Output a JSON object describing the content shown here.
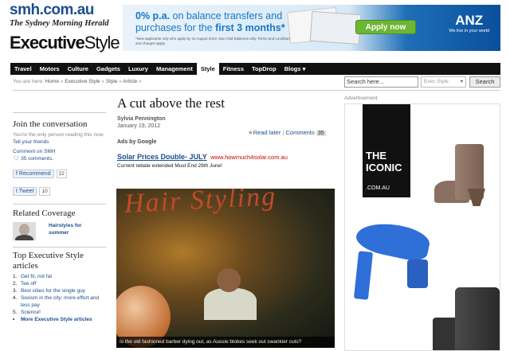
{
  "masthead": {
    "site": "smh.com.au",
    "paper": "The Sydney Morning Herald",
    "section_a": "Executive",
    "section_b": "Style"
  },
  "banner": {
    "headline_a": "0% p.a.",
    "headline_b": " on balance transfers and",
    "headline_c": "purchases for the ",
    "headline_d": "first 3 months*",
    "small_print": "*New applicants only who apply by 31 August 2012. Non ANZ balances only. Terms and conditions, fees and charges apply.",
    "apply_label": "Apply now",
    "brand": "ANZ",
    "brand_tagline": "We live in your world"
  },
  "nav": {
    "items": [
      "Travel",
      "Motors",
      "Culture",
      "Gadgets",
      "Luxury",
      "Management",
      "Style",
      "Fitness",
      "TopDrop",
      "Blogs ▾"
    ],
    "active_index": 6
  },
  "breadcrumb": {
    "prefix": "You are here:",
    "items": [
      "Home",
      "Executive Style",
      "Style",
      "Article"
    ]
  },
  "search": {
    "placeholder": "Search here...",
    "scope": "Exec Style",
    "button": "Search"
  },
  "left": {
    "join_title": "Join the conversation",
    "join_text": "You're the only person reading this now.",
    "join_link": "Tell your friends",
    "comment_on": "Comment on SMH",
    "comments_count": "35 comments.",
    "recommend_label": "Recommend",
    "recommend_count": "22",
    "tweet_label": "Tweet",
    "tweet_count": "10",
    "related_title": "Related Coverage",
    "related_item": "Hairstyles for summer",
    "top_title": "Top Executive Style articles",
    "top_items": [
      "Get fit, not fat",
      "Tee off",
      "Best cities for the single guy",
      "Sexism in the city: more effort and less pay",
      "Science!"
    ],
    "more_link": "More Executive Style articles"
  },
  "article": {
    "title": "A cut above the rest",
    "author": "Sylvia Pennington",
    "date": "January 19, 2012",
    "read_later": "Read later",
    "comments_label": "Comments",
    "comments_count": "35",
    "ads_by": "Ads by Google",
    "ad_title": "Solar Prices Double- JULY",
    "ad_url": "www.howmuch4solar.com.au",
    "ad_desc": "Current rebate extended Must End 29th June!",
    "photo_sign": "Hair Styling",
    "caption": "Is the old fashioned barber dying out, as Aussie blokes seek out swankier cuts?"
  },
  "right": {
    "ad_label": "Advertisement",
    "brand_line1": "THE",
    "brand_line2": "ICONIC",
    "brand_domain": ".COM.AU"
  },
  "colors": {
    "link": "#1a4e8c",
    "nav_bg": "#111111",
    "anz_blue": "#0b4f9c",
    "apply_green": "#6db535",
    "ad_url": "#cc0000"
  }
}
